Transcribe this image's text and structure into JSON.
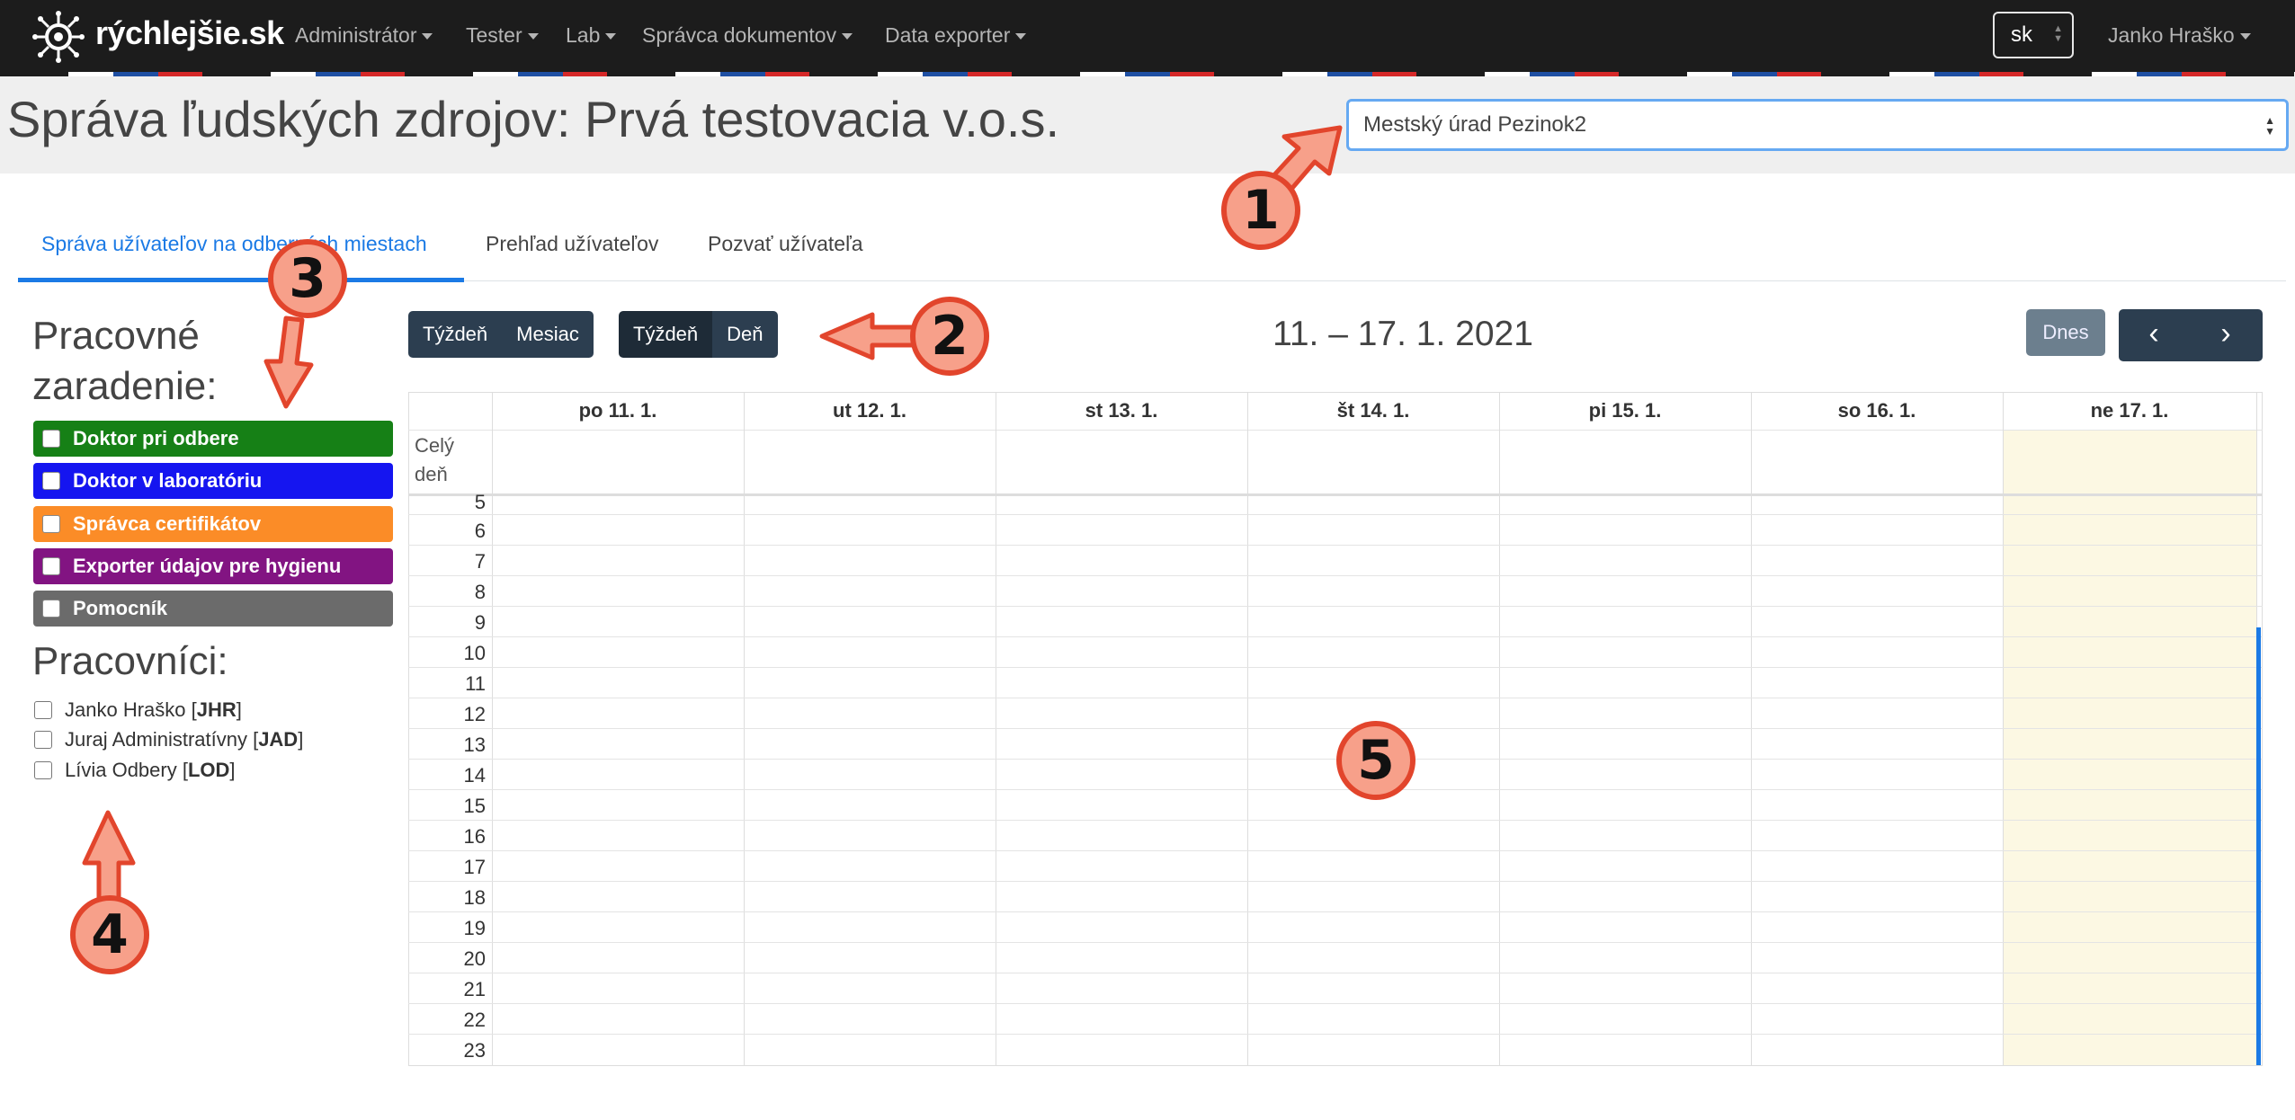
{
  "navbar": {
    "brand": "rýchlejšie.sk",
    "menu": [
      "Administrátor",
      "Tester",
      "Lab",
      "Správca dokumentov",
      "Data exporter"
    ],
    "language": "sk",
    "user": "Janko Hraško"
  },
  "header": {
    "title": "Správa ľudských zdrojov: Prvá testovacia v.o.s.",
    "place_selected": "Mestský úrad Pezinok2"
  },
  "tabs": [
    {
      "label": "Správa užívateľov na odberných miestach",
      "active": true
    },
    {
      "label": "Prehľad užívateľov",
      "active": false
    },
    {
      "label": "Pozvať užívateľa",
      "active": false
    }
  ],
  "sidebar": {
    "roles_heading_line1": "Pracovné",
    "roles_heading_line2": "zaradenie:",
    "roles": [
      {
        "label": "Doktor pri odbere",
        "color": "#168016"
      },
      {
        "label": "Doktor v laboratóriu",
        "color": "#1515f0"
      },
      {
        "label": "Správca certifikátov",
        "color": "#fb8c27"
      },
      {
        "label": "Exporter údajov pre hygienu",
        "color": "#821482"
      },
      {
        "label": "Pomocník",
        "color": "#6b6b6b"
      }
    ],
    "workers_heading": "Pracovníci:",
    "workers": [
      {
        "name": "Janko Hraško [",
        "code": "JHR",
        "close": "]"
      },
      {
        "name": "Juraj Administratívny [",
        "code": "JAD",
        "close": "]"
      },
      {
        "name": "Lívia Odbery [",
        "code": "LOD",
        "close": "]"
      }
    ]
  },
  "calendar": {
    "view_group_1": [
      "Týždeň",
      "Mesiac"
    ],
    "view_group_2": [
      "Týždeň",
      "Deň"
    ],
    "title": "11. – 17. 1. 2021",
    "today_label": "Dnes",
    "prev_icon": "‹",
    "next_icon": "›",
    "allday_label_1": "Celý",
    "allday_label_2": "deň",
    "days": [
      "po 11. 1.",
      "ut 12. 1.",
      "st 13. 1.",
      "št 14. 1.",
      "pi 15. 1.",
      "so 16. 1.",
      "ne 17. 1."
    ],
    "hours": [
      "5",
      "6",
      "7",
      "8",
      "9",
      "10",
      "11",
      "12",
      "13",
      "14",
      "15",
      "16",
      "17",
      "18",
      "19",
      "20",
      "21",
      "22",
      "23"
    ]
  },
  "annotations": [
    "1",
    "2",
    "3",
    "4",
    "5"
  ],
  "colors": {
    "navbar": "#1c1c1c",
    "accent": "#1b7ae5",
    "button_dark": "#2c3e50",
    "today_highlight": "#fcf8e3",
    "callout_fill": "#f7a08a",
    "callout_stroke": "#e2452c"
  }
}
